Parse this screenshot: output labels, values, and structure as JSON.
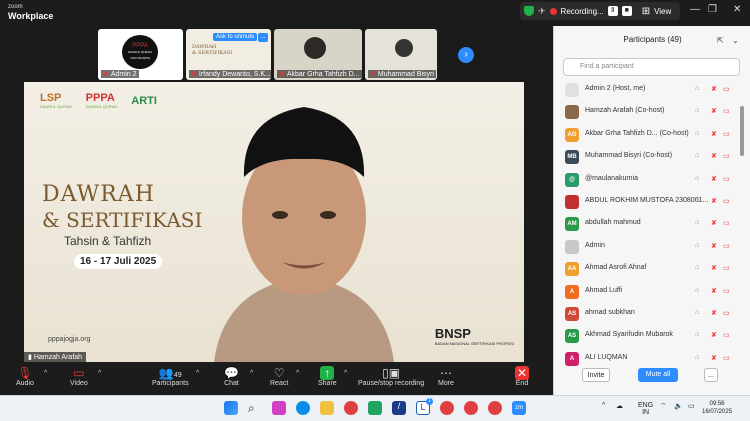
{
  "app": {
    "brand_small": "zoom",
    "brand_big": "Workplace"
  },
  "recording_bar": {
    "status": "Recording...",
    "view_label": "View"
  },
  "thumbnails": [
    {
      "name": "Admin 2",
      "sub": "DAARUL QURAN YOGYAKARTA"
    },
    {
      "name": "Irfandy Dewanto, S.K...",
      "overlay": "Ask to unmute"
    },
    {
      "name": "Akbar Grha Tahfizh D..."
    },
    {
      "name": "Muhammad Bisyri"
    }
  ],
  "slide": {
    "logos": [
      "LSP",
      "PPPA",
      "ARTI"
    ],
    "lsp_sub": "DAARUL QURAN",
    "pppa_sub": "DAARUL QURAN",
    "line1": "DAWRAH",
    "line2": "& SERTIFIKASI",
    "line3": "Tahsin & Tahfizh",
    "date": "16 - 17 Juli 2025",
    "website": "pppajogja.org",
    "bnsp": "BNSP",
    "bnsp_sub": "BADAN NASIONAL SERTIFIKASI PROFESI"
  },
  "active_speaker": "Hamzah Arafah",
  "toolbar": {
    "audio": "Audio",
    "video": "Video",
    "participants": "Participants",
    "participants_count": "49",
    "chat": "Chat",
    "react": "React",
    "share": "Share",
    "record": "Pause/stop recording",
    "more": "More",
    "end": "End"
  },
  "panel": {
    "title": "Participants (49)",
    "search_placeholder": "Find a participant",
    "participants": [
      {
        "initials": "",
        "color": "#e0e0e0",
        "name": "Admin 2 (Host, me)"
      },
      {
        "initials": "",
        "color": "#8a6a4a",
        "name": "Hamzah Arafah (Co-host)"
      },
      {
        "initials": "AG",
        "color": "#f0a030",
        "name": "Akbar Grha Tahfizh D... (Co-host)"
      },
      {
        "initials": "MB",
        "color": "#3b4a5a",
        "name": "Muhammad Bisyri (Co-host)"
      },
      {
        "initials": "@",
        "color": "#2a9a6a",
        "name": "@maulanakurnia"
      },
      {
        "initials": "",
        "color": "#c03030",
        "name": "ABDUL ROKHIM MUSTOFA 2308001..."
      },
      {
        "initials": "AM",
        "color": "#2a9a4a",
        "name": "abdullah mahmud"
      },
      {
        "initials": "",
        "color": "#c8c8c8",
        "name": "Admin"
      },
      {
        "initials": "AA",
        "color": "#f0a030",
        "name": "Ahmad Asrofi Ahnaf"
      },
      {
        "initials": "A",
        "color": "#f06a20",
        "name": "Ahmad Luffi"
      },
      {
        "initials": "AS",
        "color": "#d04a3a",
        "name": "ahmad subkhan"
      },
      {
        "initials": "AS",
        "color": "#2a9a4a",
        "name": "Akhmad Syarifudin Mubarok"
      },
      {
        "initials": "A",
        "color": "#d0206a",
        "name": "ALI LUQMAN"
      }
    ],
    "invite": "Invite",
    "mute_all": "Mute all",
    "more": "..."
  },
  "taskbar": {
    "lang": "ENG",
    "region": "IN",
    "time": "09:56",
    "date": "16/07/2025",
    "badge": "1"
  },
  "colors": {
    "accent": "#2d8cff",
    "danger": "#e33333",
    "panel_bg": "#f6f6f6"
  }
}
